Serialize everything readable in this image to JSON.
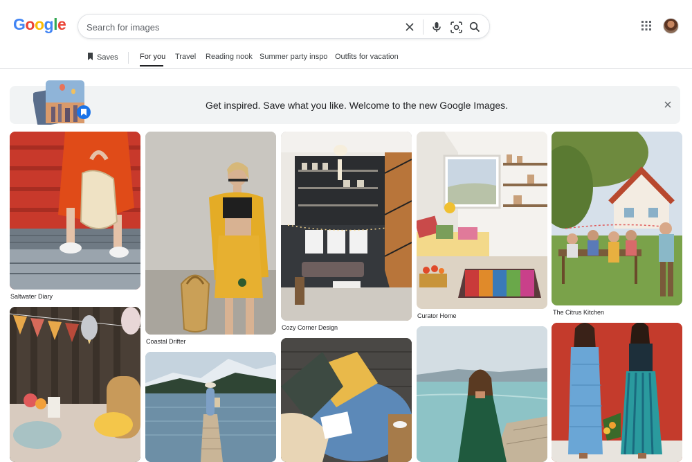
{
  "header": {
    "logo_letters": [
      {
        "ch": "G",
        "color": "#4285F4"
      },
      {
        "ch": "o",
        "color": "#EA4335"
      },
      {
        "ch": "o",
        "color": "#FBBC05"
      },
      {
        "ch": "g",
        "color": "#4285F4"
      },
      {
        "ch": "l",
        "color": "#34A853"
      },
      {
        "ch": "e",
        "color": "#EA4335"
      }
    ],
    "search_placeholder": "Search for images",
    "icons": [
      "clear-icon",
      "mic-icon",
      "lens-icon",
      "search-icon",
      "apps-icon",
      "avatar"
    ]
  },
  "nav": {
    "saves_label": "Saves",
    "tabs": [
      {
        "label": "For you",
        "active": true
      },
      {
        "label": "Travel",
        "active": false
      },
      {
        "label": "Reading nook",
        "active": false
      },
      {
        "label": "Summer party inspo",
        "active": false
      },
      {
        "label": "Outfits for vacation",
        "active": false
      }
    ]
  },
  "banner": {
    "text": "Get inspired. Save what you like. Welcome to the new Google Images."
  },
  "tiles": [
    {
      "caption": "Saltwater Diary"
    },
    {
      "caption": ""
    },
    {
      "caption": "Coastal Drifter"
    },
    {
      "caption": ""
    },
    {
      "caption": "Cozy Corner Design"
    },
    {
      "caption": ""
    },
    {
      "caption": "Curator Home"
    },
    {
      "caption": ""
    },
    {
      "caption": "The Citrus Kitchen"
    },
    {
      "caption": ""
    }
  ],
  "colors": {
    "accent_blue": "#1a73e8",
    "text": "#202124",
    "muted": "#5f6368",
    "banner_bg": "#f1f3f4"
  }
}
